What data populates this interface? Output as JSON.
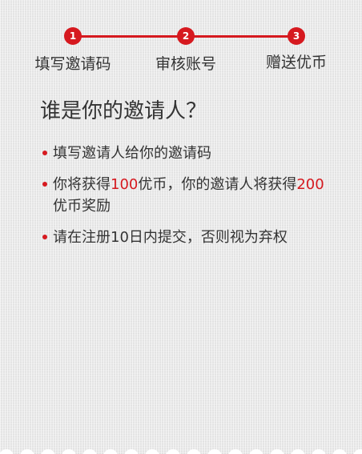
{
  "steps": [
    {
      "number": "1",
      "label": "填写邀请码"
    },
    {
      "number": "2",
      "label": "审核账号"
    },
    {
      "number": "3",
      "label": "赠送优币"
    }
  ],
  "title": "谁是你的邀请人？",
  "rules": {
    "r1": {
      "text": "填写邀请人给你的邀请码"
    },
    "r2": {
      "p1": "你将获得",
      "n1": "100",
      "p2": "优币，你的邀请人将获得",
      "n2": "200",
      "p3": "优币奖励"
    },
    "r3": {
      "text": "请在注册10日内提交，否则视为弃权"
    }
  },
  "colors": {
    "accent": "#d6191f",
    "text": "#333333",
    "background": "#e8e8e8"
  }
}
